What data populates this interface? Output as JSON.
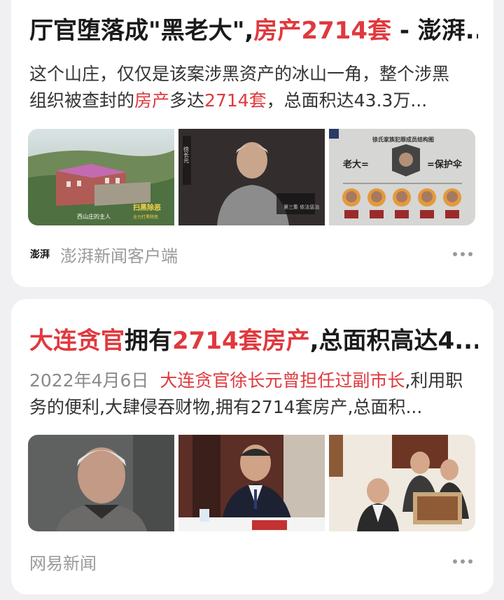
{
  "results": [
    {
      "title_parts": [
        {
          "text": "厅官堕落成\"黑老大\",",
          "hl": false
        },
        {
          "text": "房产2714套",
          "hl": true
        },
        {
          "text": " - 澎湃...",
          "hl": false
        }
      ],
      "snippet_parts": [
        {
          "text": "这个山庄，仅仅是该案涉黑资产的冰山一角，整个涉黑组织被查封的",
          "hl": false
        },
        {
          "text": "房产",
          "hl": true
        },
        {
          "text": "多达",
          "hl": false
        },
        {
          "text": "2714套",
          "hl": true
        },
        {
          "text": "，总面积达43.3万...",
          "hl": false
        }
      ],
      "images": [
        {
          "caption": "西山庄的主人",
          "stamp": "扫黑除恶",
          "stamp_sub": "全力打黑除恶"
        },
        {
          "caption": "徐长元",
          "stamp": "第三集 依法惩治"
        },
        {
          "caption": "徐氏家族犯罪成员结构图",
          "label_left": "老大=",
          "label_right": "=保护伞"
        }
      ],
      "source": "澎湃新闻客户端",
      "source_logo": "澎湃"
    },
    {
      "title_parts": [
        {
          "text": "大连贪官",
          "hl": true
        },
        {
          "text": "拥有",
          "hl": false
        },
        {
          "text": "2714套房产",
          "hl": true
        },
        {
          "text": ",总面积高达4...",
          "hl": false
        }
      ],
      "date": "2022年4月6日",
      "snippet_parts": [
        {
          "text": "大连贪官徐长元曾担任过副市长",
          "hl": true
        },
        {
          "text": ",利用职务的便利,大肆侵吞财物,拥有2714套房产,总面积...",
          "hl": false
        }
      ],
      "images": [
        {
          "caption": "portrait"
        },
        {
          "caption": "meeting"
        },
        {
          "caption": "inspection"
        }
      ],
      "source": "网易新闻"
    }
  ],
  "colors": {
    "highlight": "#e0393e",
    "muted": "#9a9a9a",
    "background": "#f0f0f2"
  }
}
